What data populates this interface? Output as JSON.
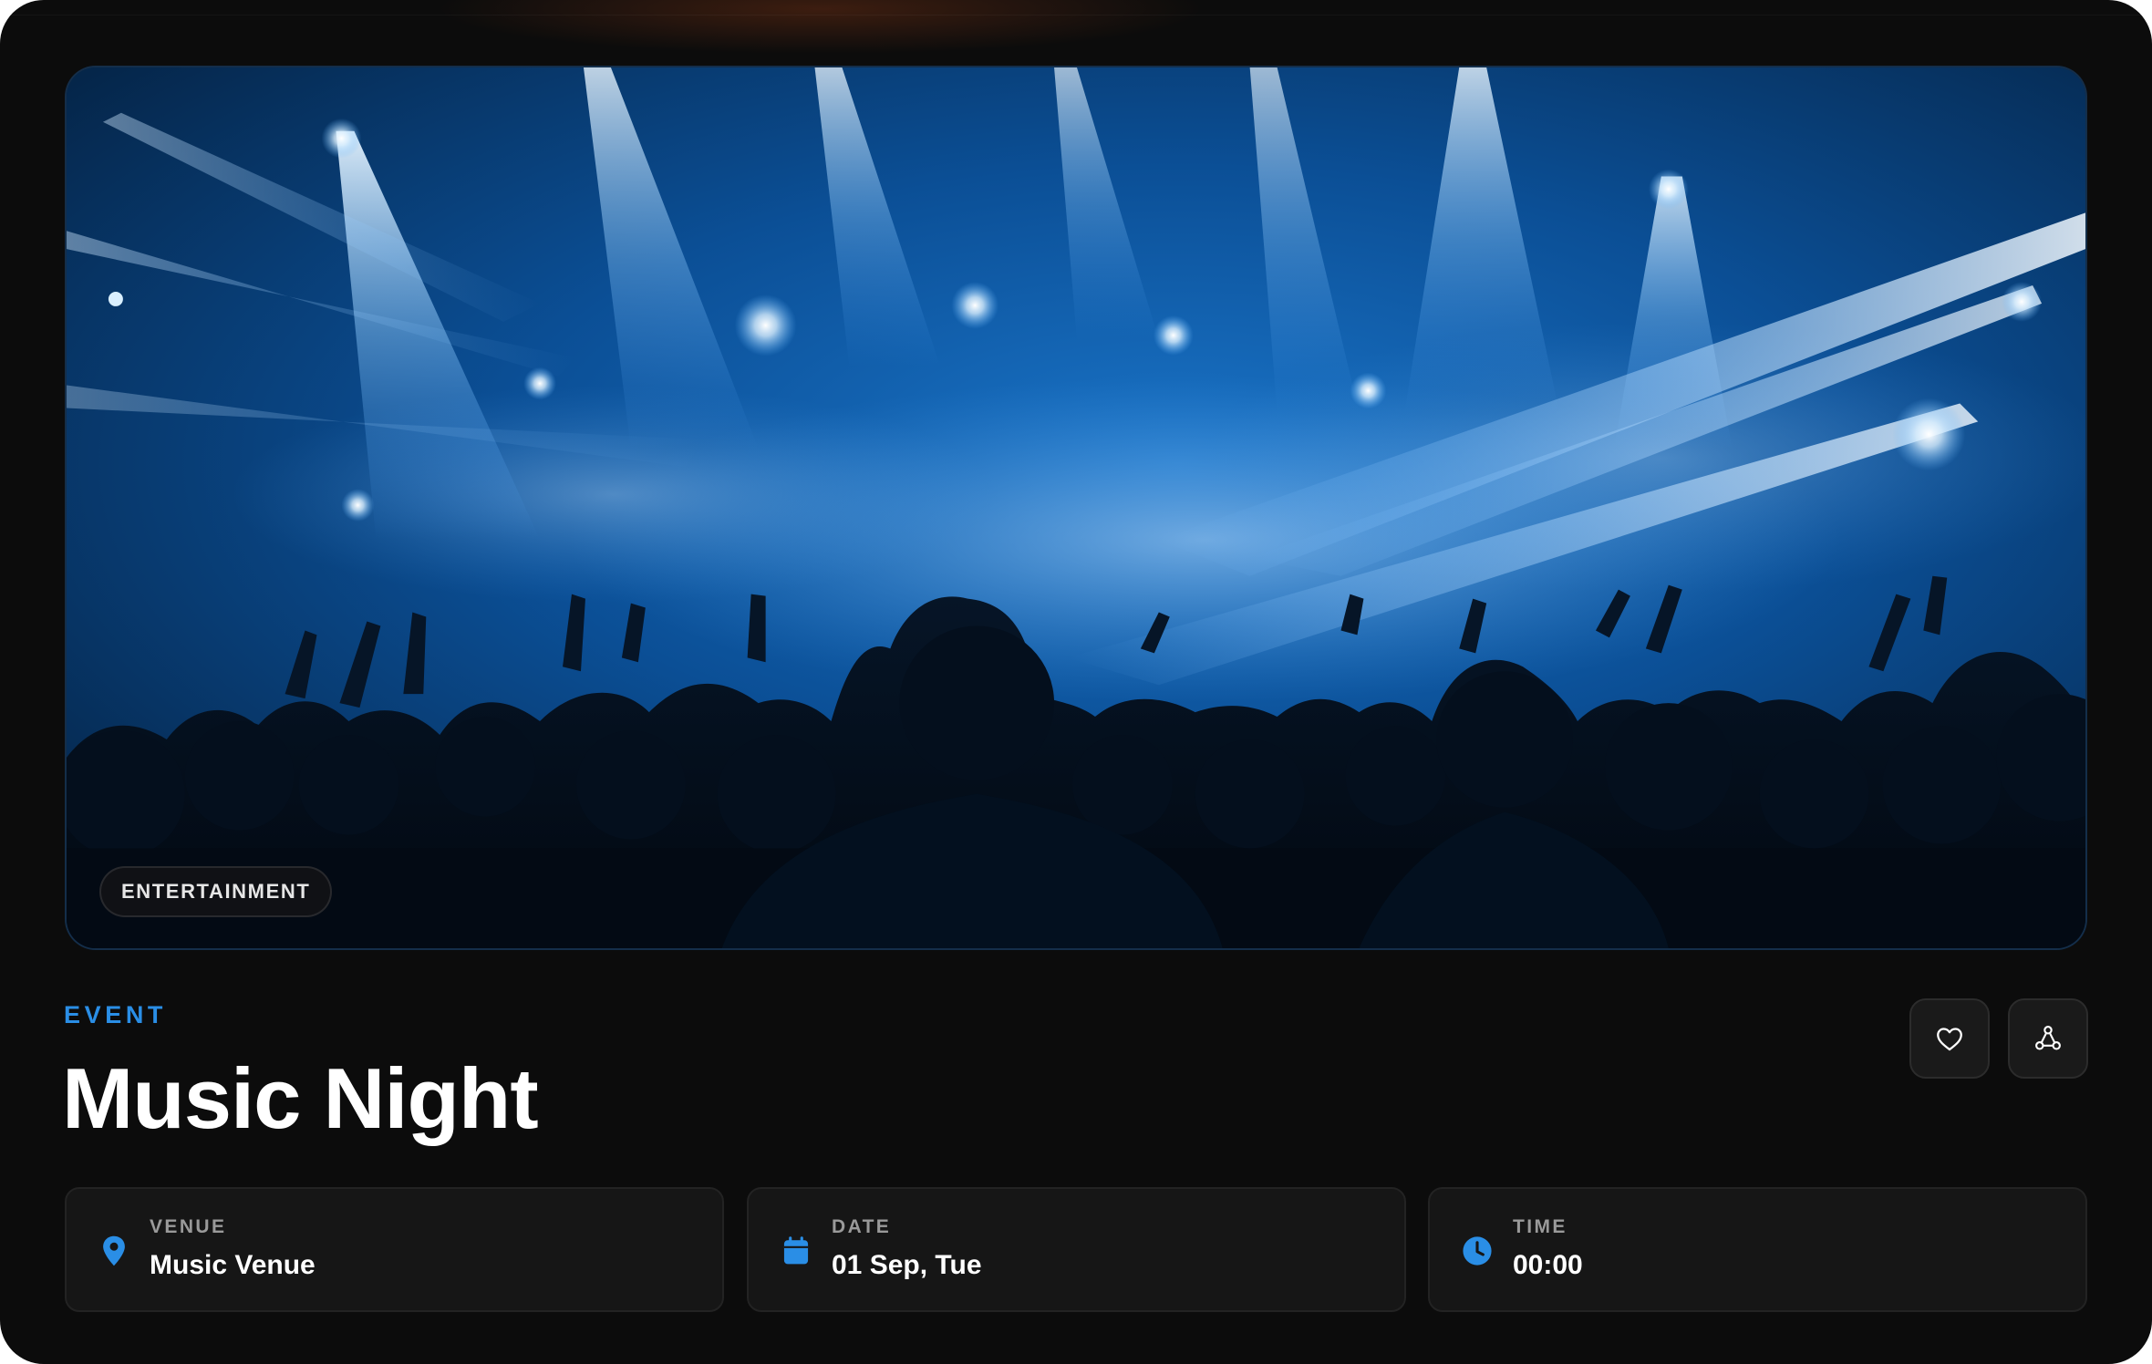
{
  "hero": {
    "image": "concert-crowd-blue-stage-lights",
    "category": "ENTERTAINMENT"
  },
  "event": {
    "eyebrow": "EVENT",
    "title": "Music Night"
  },
  "actions": {
    "favorite_icon": "heart-icon",
    "share_icon": "share-icon"
  },
  "details": [
    {
      "label": "VENUE",
      "value": "Music Venue",
      "icon": "map-pin-icon"
    },
    {
      "label": "DATE",
      "value": "01 Sep, Tue",
      "icon": "calendar-icon"
    },
    {
      "label": "TIME",
      "value": "00:00",
      "icon": "clock-icon"
    }
  ],
  "colors": {
    "accent": "#2a8ee6",
    "background": "#0c0c0c",
    "tile": "#161616"
  }
}
